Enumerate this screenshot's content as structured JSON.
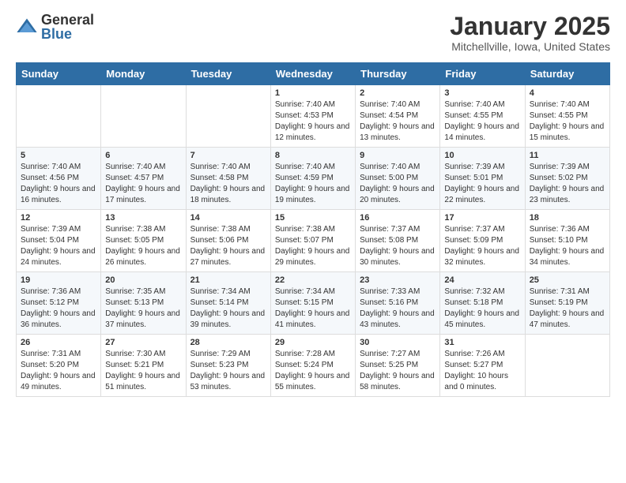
{
  "header": {
    "logo_general": "General",
    "logo_blue": "Blue",
    "month_title": "January 2025",
    "location": "Mitchellville, Iowa, United States"
  },
  "days_of_week": [
    "Sunday",
    "Monday",
    "Tuesday",
    "Wednesday",
    "Thursday",
    "Friday",
    "Saturday"
  ],
  "weeks": [
    [
      {
        "day": "",
        "sunrise": "",
        "sunset": "",
        "daylight": ""
      },
      {
        "day": "",
        "sunrise": "",
        "sunset": "",
        "daylight": ""
      },
      {
        "day": "",
        "sunrise": "",
        "sunset": "",
        "daylight": ""
      },
      {
        "day": "1",
        "sunrise": "Sunrise: 7:40 AM",
        "sunset": "Sunset: 4:53 PM",
        "daylight": "Daylight: 9 hours and 12 minutes."
      },
      {
        "day": "2",
        "sunrise": "Sunrise: 7:40 AM",
        "sunset": "Sunset: 4:54 PM",
        "daylight": "Daylight: 9 hours and 13 minutes."
      },
      {
        "day": "3",
        "sunrise": "Sunrise: 7:40 AM",
        "sunset": "Sunset: 4:55 PM",
        "daylight": "Daylight: 9 hours and 14 minutes."
      },
      {
        "day": "4",
        "sunrise": "Sunrise: 7:40 AM",
        "sunset": "Sunset: 4:55 PM",
        "daylight": "Daylight: 9 hours and 15 minutes."
      }
    ],
    [
      {
        "day": "5",
        "sunrise": "Sunrise: 7:40 AM",
        "sunset": "Sunset: 4:56 PM",
        "daylight": "Daylight: 9 hours and 16 minutes."
      },
      {
        "day": "6",
        "sunrise": "Sunrise: 7:40 AM",
        "sunset": "Sunset: 4:57 PM",
        "daylight": "Daylight: 9 hours and 17 minutes."
      },
      {
        "day": "7",
        "sunrise": "Sunrise: 7:40 AM",
        "sunset": "Sunset: 4:58 PM",
        "daylight": "Daylight: 9 hours and 18 minutes."
      },
      {
        "day": "8",
        "sunrise": "Sunrise: 7:40 AM",
        "sunset": "Sunset: 4:59 PM",
        "daylight": "Daylight: 9 hours and 19 minutes."
      },
      {
        "day": "9",
        "sunrise": "Sunrise: 7:40 AM",
        "sunset": "Sunset: 5:00 PM",
        "daylight": "Daylight: 9 hours and 20 minutes."
      },
      {
        "day": "10",
        "sunrise": "Sunrise: 7:39 AM",
        "sunset": "Sunset: 5:01 PM",
        "daylight": "Daylight: 9 hours and 22 minutes."
      },
      {
        "day": "11",
        "sunrise": "Sunrise: 7:39 AM",
        "sunset": "Sunset: 5:02 PM",
        "daylight": "Daylight: 9 hours and 23 minutes."
      }
    ],
    [
      {
        "day": "12",
        "sunrise": "Sunrise: 7:39 AM",
        "sunset": "Sunset: 5:04 PM",
        "daylight": "Daylight: 9 hours and 24 minutes."
      },
      {
        "day": "13",
        "sunrise": "Sunrise: 7:38 AM",
        "sunset": "Sunset: 5:05 PM",
        "daylight": "Daylight: 9 hours and 26 minutes."
      },
      {
        "day": "14",
        "sunrise": "Sunrise: 7:38 AM",
        "sunset": "Sunset: 5:06 PM",
        "daylight": "Daylight: 9 hours and 27 minutes."
      },
      {
        "day": "15",
        "sunrise": "Sunrise: 7:38 AM",
        "sunset": "Sunset: 5:07 PM",
        "daylight": "Daylight: 9 hours and 29 minutes."
      },
      {
        "day": "16",
        "sunrise": "Sunrise: 7:37 AM",
        "sunset": "Sunset: 5:08 PM",
        "daylight": "Daylight: 9 hours and 30 minutes."
      },
      {
        "day": "17",
        "sunrise": "Sunrise: 7:37 AM",
        "sunset": "Sunset: 5:09 PM",
        "daylight": "Daylight: 9 hours and 32 minutes."
      },
      {
        "day": "18",
        "sunrise": "Sunrise: 7:36 AM",
        "sunset": "Sunset: 5:10 PM",
        "daylight": "Daylight: 9 hours and 34 minutes."
      }
    ],
    [
      {
        "day": "19",
        "sunrise": "Sunrise: 7:36 AM",
        "sunset": "Sunset: 5:12 PM",
        "daylight": "Daylight: 9 hours and 36 minutes."
      },
      {
        "day": "20",
        "sunrise": "Sunrise: 7:35 AM",
        "sunset": "Sunset: 5:13 PM",
        "daylight": "Daylight: 9 hours and 37 minutes."
      },
      {
        "day": "21",
        "sunrise": "Sunrise: 7:34 AM",
        "sunset": "Sunset: 5:14 PM",
        "daylight": "Daylight: 9 hours and 39 minutes."
      },
      {
        "day": "22",
        "sunrise": "Sunrise: 7:34 AM",
        "sunset": "Sunset: 5:15 PM",
        "daylight": "Daylight: 9 hours and 41 minutes."
      },
      {
        "day": "23",
        "sunrise": "Sunrise: 7:33 AM",
        "sunset": "Sunset: 5:16 PM",
        "daylight": "Daylight: 9 hours and 43 minutes."
      },
      {
        "day": "24",
        "sunrise": "Sunrise: 7:32 AM",
        "sunset": "Sunset: 5:18 PM",
        "daylight": "Daylight: 9 hours and 45 minutes."
      },
      {
        "day": "25",
        "sunrise": "Sunrise: 7:31 AM",
        "sunset": "Sunset: 5:19 PM",
        "daylight": "Daylight: 9 hours and 47 minutes."
      }
    ],
    [
      {
        "day": "26",
        "sunrise": "Sunrise: 7:31 AM",
        "sunset": "Sunset: 5:20 PM",
        "daylight": "Daylight: 9 hours and 49 minutes."
      },
      {
        "day": "27",
        "sunrise": "Sunrise: 7:30 AM",
        "sunset": "Sunset: 5:21 PM",
        "daylight": "Daylight: 9 hours and 51 minutes."
      },
      {
        "day": "28",
        "sunrise": "Sunrise: 7:29 AM",
        "sunset": "Sunset: 5:23 PM",
        "daylight": "Daylight: 9 hours and 53 minutes."
      },
      {
        "day": "29",
        "sunrise": "Sunrise: 7:28 AM",
        "sunset": "Sunset: 5:24 PM",
        "daylight": "Daylight: 9 hours and 55 minutes."
      },
      {
        "day": "30",
        "sunrise": "Sunrise: 7:27 AM",
        "sunset": "Sunset: 5:25 PM",
        "daylight": "Daylight: 9 hours and 58 minutes."
      },
      {
        "day": "31",
        "sunrise": "Sunrise: 7:26 AM",
        "sunset": "Sunset: 5:27 PM",
        "daylight": "Daylight: 10 hours and 0 minutes."
      },
      {
        "day": "",
        "sunrise": "",
        "sunset": "",
        "daylight": ""
      }
    ]
  ]
}
